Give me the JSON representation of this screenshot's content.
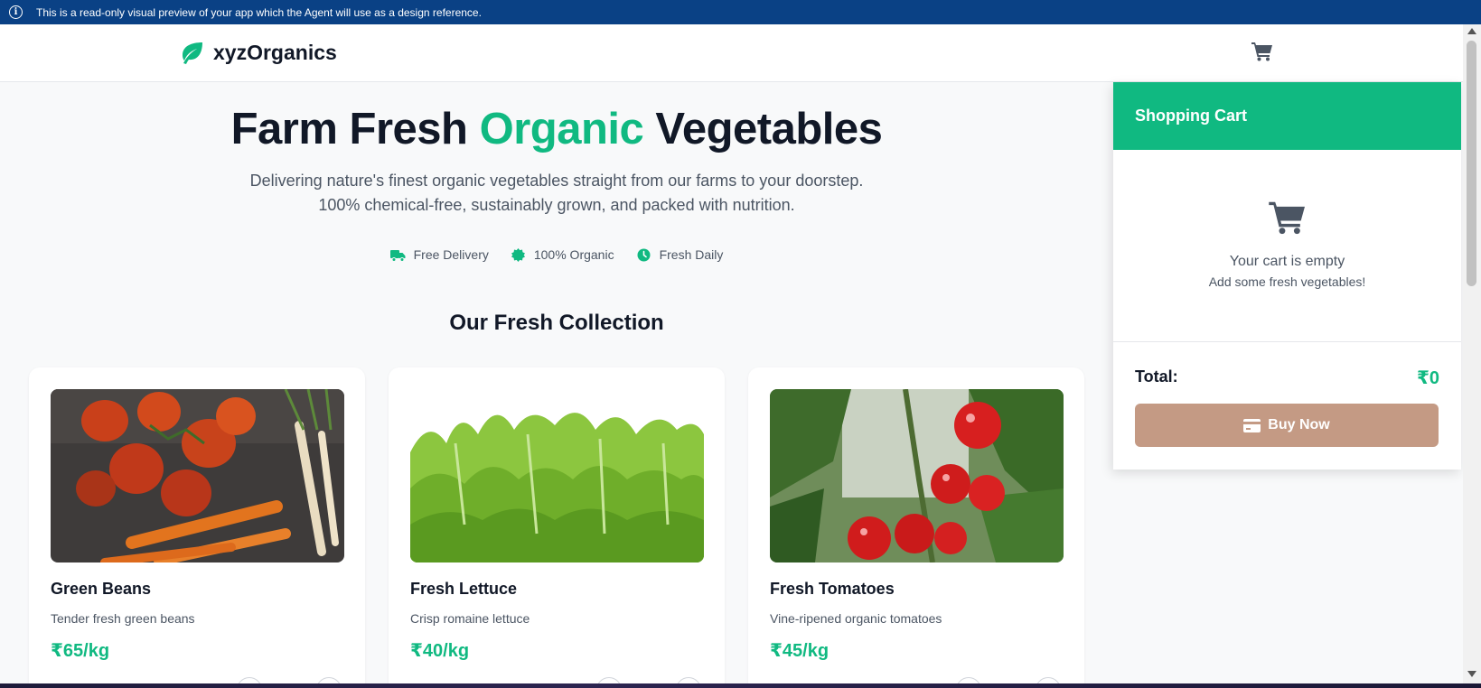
{
  "banner": {
    "text": "This is a read-only visual preview of your app which the Agent will use as a design reference.",
    "icon": "info-icon"
  },
  "header": {
    "brand": "xyzOrganics",
    "logo_icon": "leaf-icon",
    "cart_icon": "cart-icon"
  },
  "hero": {
    "title_before": "Farm Fresh",
    "title_accent": "Organic",
    "title_after": "Vegetables",
    "subtitle": "Delivering nature's finest organic vegetables straight from our farms to your doorstep. 100% chemical-free, sustainably grown, and packed with nutrition."
  },
  "badges": [
    {
      "icon": "truck-icon",
      "label": "Free Delivery"
    },
    {
      "icon": "certificate-icon",
      "label": "100% Organic"
    },
    {
      "icon": "clock-icon",
      "label": "Fresh Daily"
    }
  ],
  "collection": {
    "title": "Our Fresh Collection",
    "products": [
      {
        "name": "Green Beans",
        "description": "Tender fresh green beans",
        "price": "₹65/kg",
        "image": "tomatoes-and-carrots-image"
      },
      {
        "name": "Fresh Lettuce",
        "description": "Crisp romaine lettuce",
        "price": "₹40/kg",
        "image": "lettuce-image"
      },
      {
        "name": "Fresh Tomatoes",
        "description": "Vine-ripened organic tomatoes",
        "price": "₹45/kg",
        "image": "tomato-vine-image"
      }
    ]
  },
  "cart": {
    "title": "Shopping Cart",
    "empty_message": "Your cart is empty",
    "empty_hint": "Add some fresh vegetables!",
    "total_label": "Total:",
    "total_value": "₹0",
    "buy_label": "Buy Now",
    "buy_icon": "credit-card-icon"
  },
  "colors": {
    "accent": "#10b981",
    "banner": "#0a4185",
    "buy_button": "#c49a84",
    "text": "#111827",
    "muted": "#4b5563"
  }
}
